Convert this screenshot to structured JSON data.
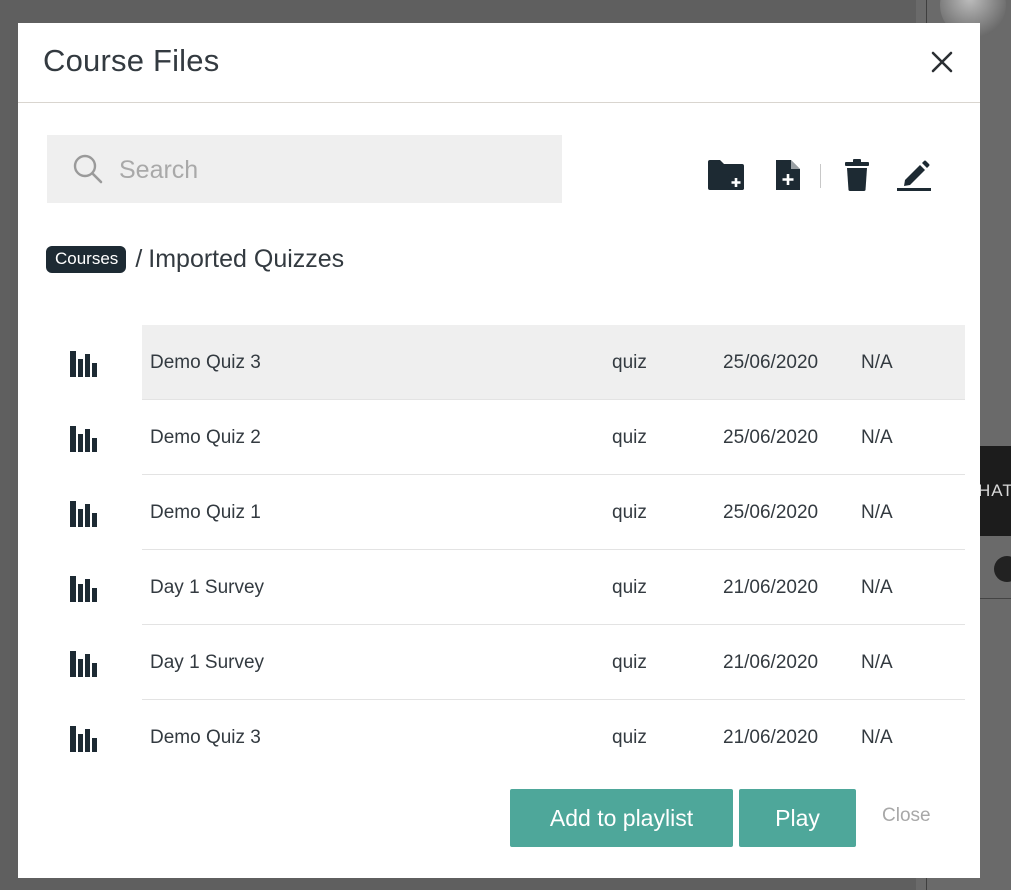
{
  "background": {
    "chat_label": "HAT"
  },
  "modal": {
    "title": "Course Files",
    "close_icon": "close-icon"
  },
  "search": {
    "placeholder": "Search",
    "value": ""
  },
  "toolbar": {
    "icons": [
      "new-folder-icon",
      "new-file-icon",
      "delete-icon",
      "edit-icon"
    ]
  },
  "breadcrumb": {
    "root": "Courses",
    "separator": "/",
    "current": "Imported Quizzes"
  },
  "files": [
    {
      "icon": "quiz-chart-icon",
      "name": "Demo Quiz 3",
      "type": "quiz",
      "date": "25/06/2020",
      "size": "N/A",
      "selected": true
    },
    {
      "icon": "quiz-chart-icon",
      "name": "Demo Quiz 2",
      "type": "quiz",
      "date": "25/06/2020",
      "size": "N/A",
      "selected": false
    },
    {
      "icon": "quiz-chart-icon",
      "name": "Demo Quiz 1",
      "type": "quiz",
      "date": "25/06/2020",
      "size": "N/A",
      "selected": false
    },
    {
      "icon": "quiz-chart-icon",
      "name": "Day 1 Survey",
      "type": "quiz",
      "date": "21/06/2020",
      "size": "N/A",
      "selected": false
    },
    {
      "icon": "quiz-chart-icon",
      "name": "Day 1 Survey",
      "type": "quiz",
      "date": "21/06/2020",
      "size": "N/A",
      "selected": false
    },
    {
      "icon": "quiz-chart-icon",
      "name": "Demo Quiz 3",
      "type": "quiz",
      "date": "21/06/2020",
      "size": "N/A",
      "selected": false
    }
  ],
  "footer": {
    "add_label": "Add to playlist",
    "play_label": "Play",
    "close_label": "Close"
  },
  "colors": {
    "accent": "#4ea79a",
    "icon": "#1d2a33",
    "selected_row": "#efefef"
  }
}
